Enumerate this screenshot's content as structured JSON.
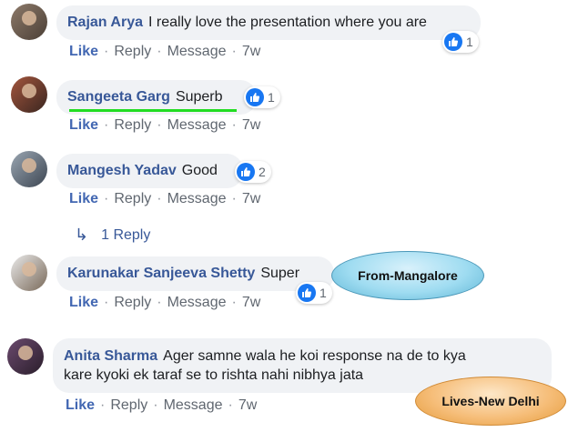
{
  "comments": [
    {
      "author": "Rajan Arya",
      "text": "I really love the presentation where you are",
      "reactions": "1",
      "actions": {
        "like": "Like",
        "reply": "Reply",
        "message": "Message",
        "time": "7w"
      }
    },
    {
      "author": "Sangeeta Garg",
      "text": "Superb",
      "reactions": "1",
      "actions": {
        "like": "Like",
        "reply": "Reply",
        "message": "Message",
        "time": "7w"
      }
    },
    {
      "author": "Mangesh Yadav",
      "text": "Good",
      "reactions": "2",
      "actions": {
        "like": "Like",
        "reply": "Reply",
        "message": "Message",
        "time": "7w"
      },
      "replies_label": "1 Reply"
    },
    {
      "author": "Karunakar Sanjeeva Shetty",
      "text": "Super",
      "reactions": "1",
      "actions": {
        "like": "Like",
        "reply": "Reply",
        "message": "Message",
        "time": "7w"
      }
    },
    {
      "author": "Anita Sharma",
      "text_line1": "Ager samne wala he koi response na de to kya",
      "text_line2": "kare kyoki ek taraf se to rishta nahi nibhya jata",
      "actions": {
        "like": "Like",
        "reply": "Reply",
        "message": "Message",
        "time": "7w"
      }
    }
  ],
  "annotations": {
    "from": "From-Mangalore",
    "lives": "Lives-New Delhi"
  },
  "icons": {
    "like": "thumbs-up-icon",
    "reply_arrow": "reply-arrow-icon"
  },
  "colors": {
    "author": "#385898",
    "like_blue": "#1877f2",
    "underline_green": "#22dd22"
  }
}
